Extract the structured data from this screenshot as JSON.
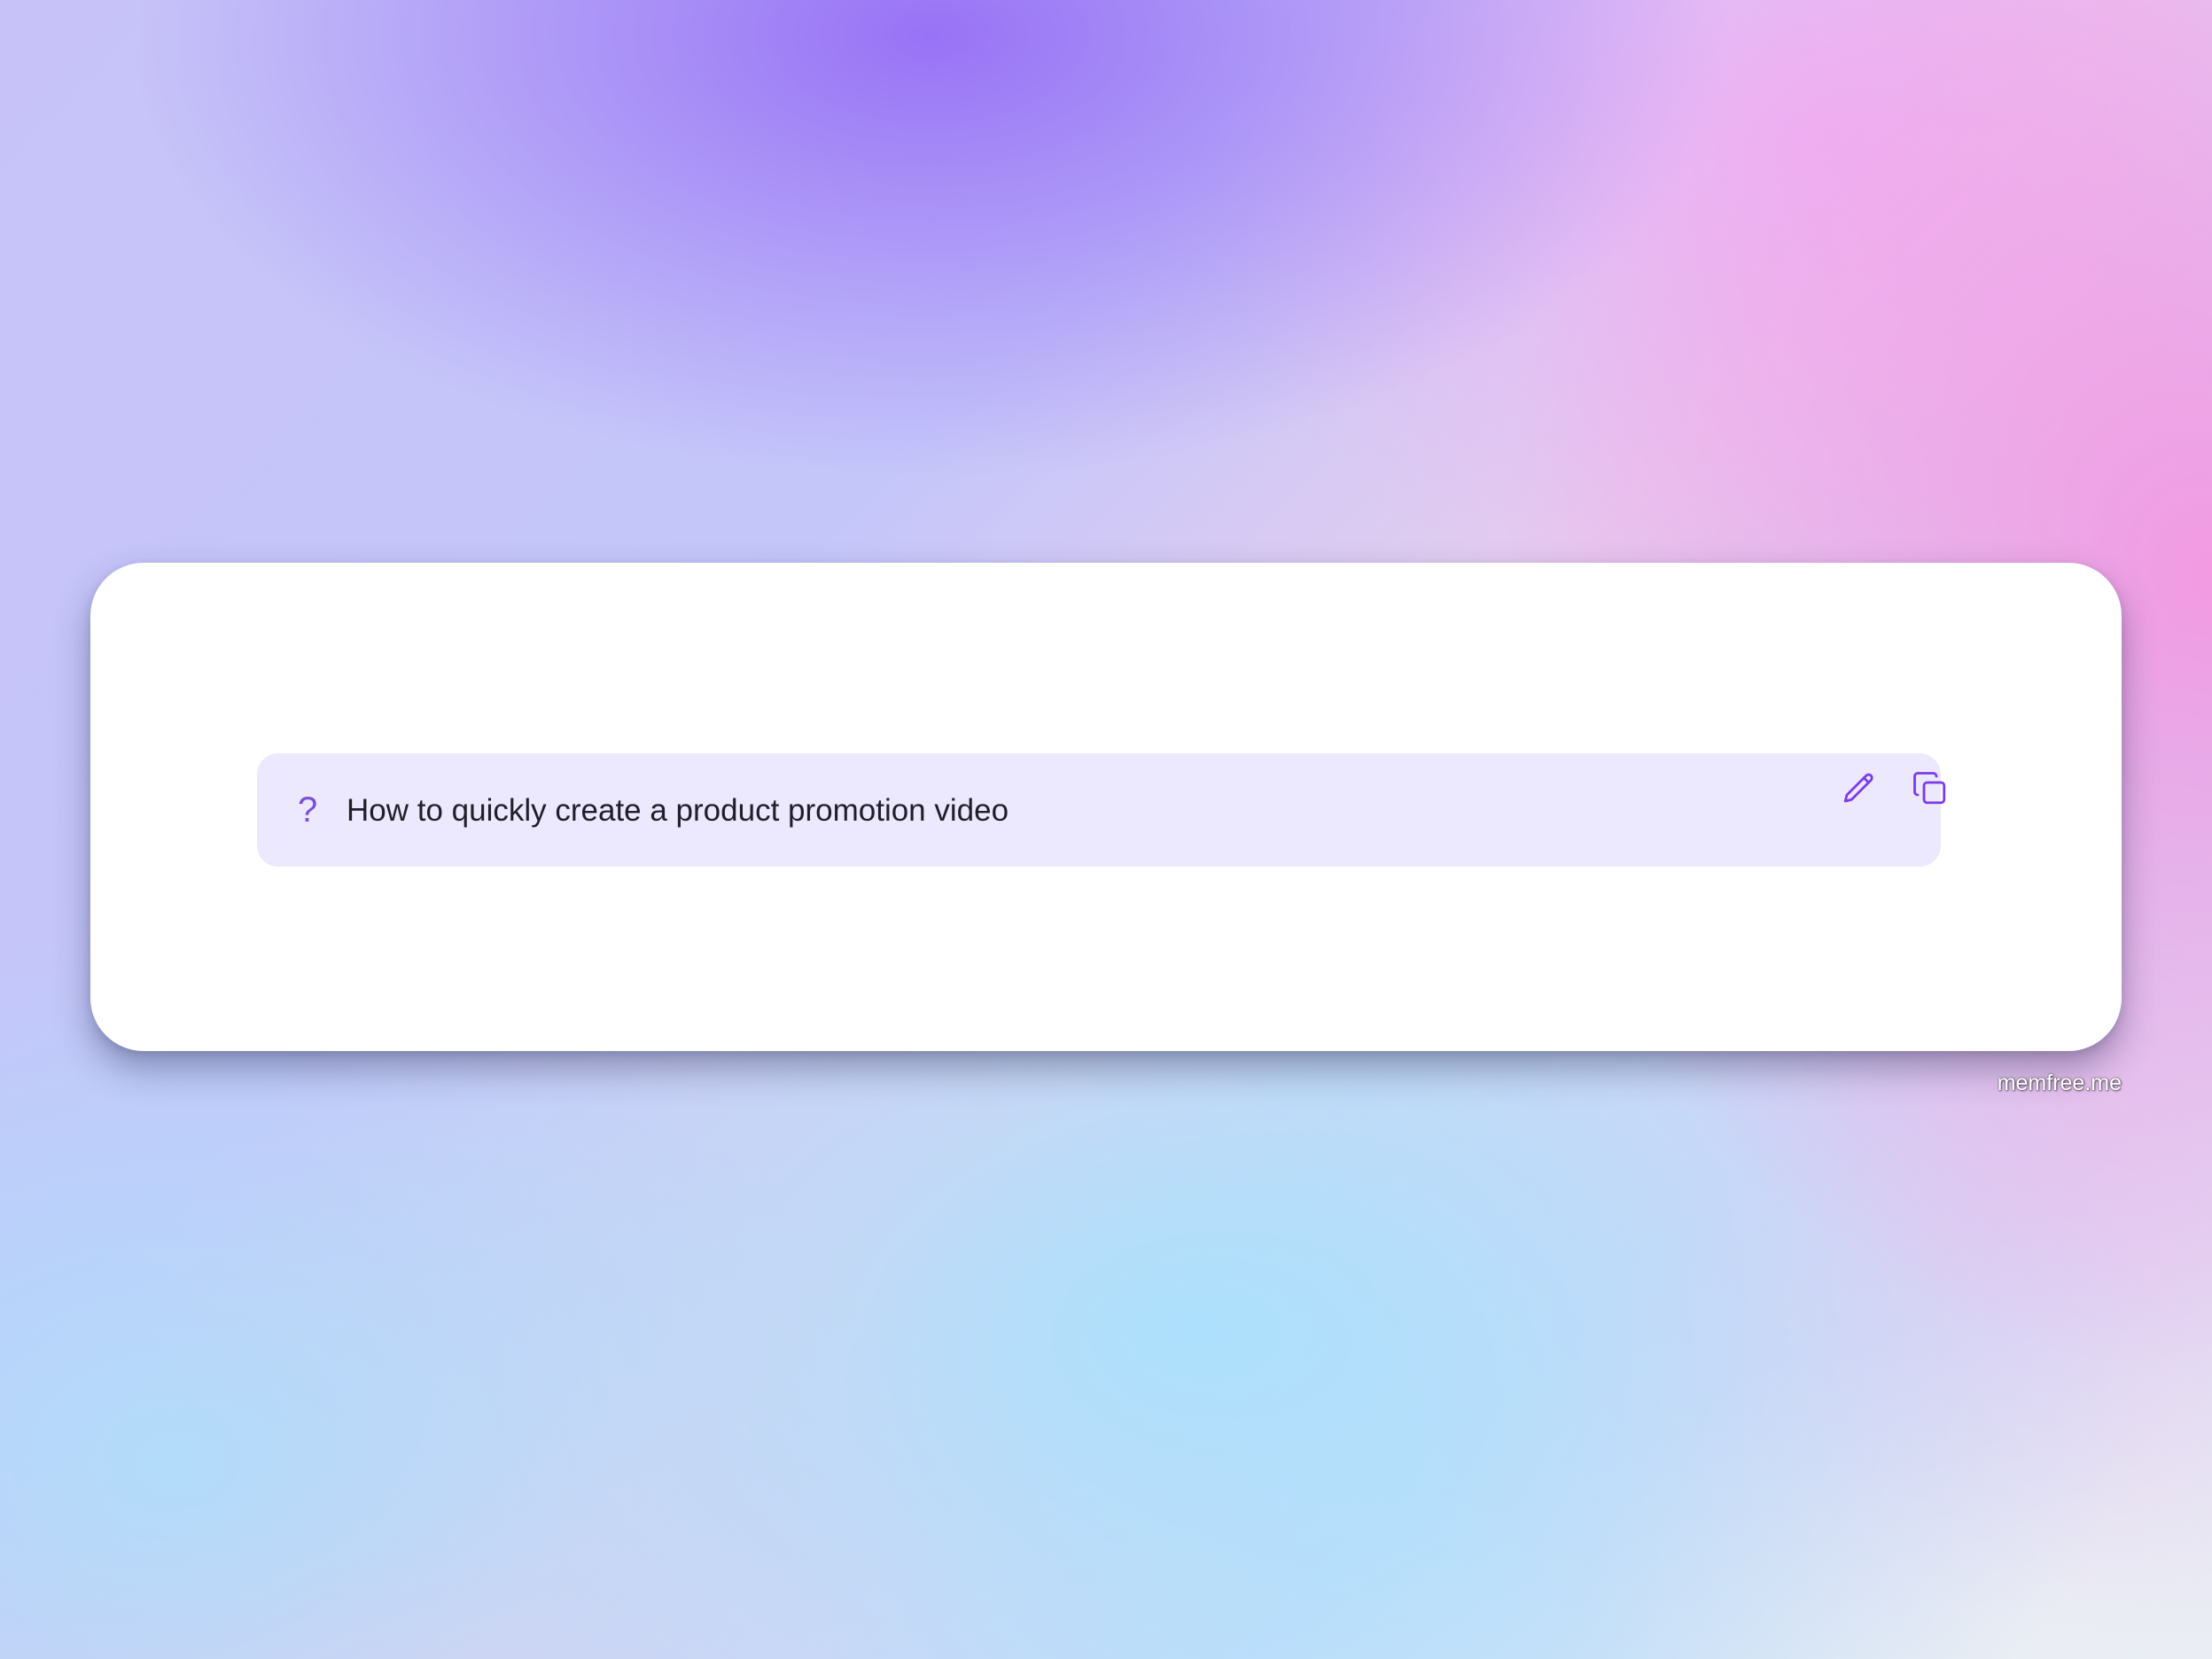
{
  "card": {
    "question": {
      "icon": "question-mark-icon",
      "mark": "?",
      "text": "How to quickly create a product promotion video",
      "actions": {
        "edit_icon": "pencil-icon",
        "copy_icon": "copy-icon"
      }
    }
  },
  "watermark": "memfree.me",
  "colors": {
    "accent": "#7c3aed",
    "question_bg": "#ece8fd",
    "card_bg": "#ffffff",
    "text": "#1f1f2a"
  }
}
